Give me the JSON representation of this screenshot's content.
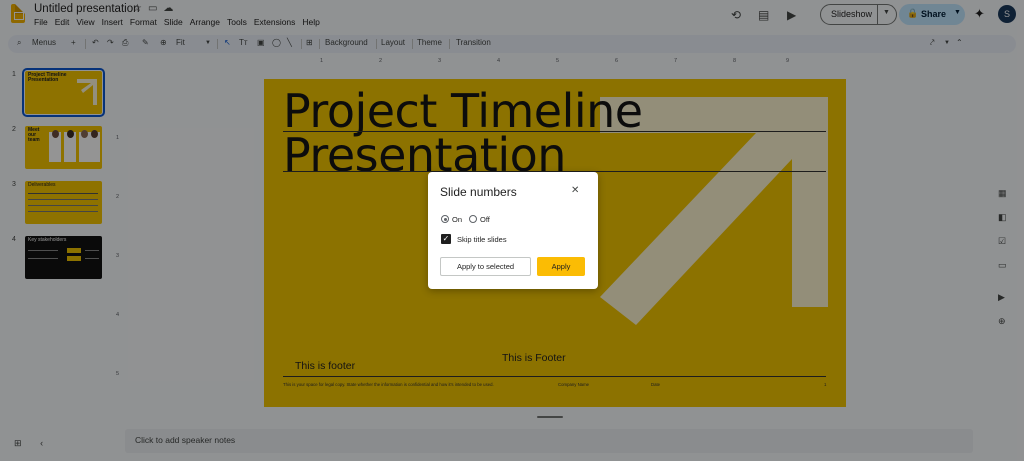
{
  "app": {
    "doc_title": "Untitled presentation",
    "menus": [
      "File",
      "Edit",
      "View",
      "Insert",
      "Format",
      "Slide",
      "Arrange",
      "Tools",
      "Extensions",
      "Help"
    ],
    "slideshow_label": "Slideshow",
    "share_label": "Share",
    "avatar_letter": "S"
  },
  "toolbar": {
    "search_label": "Menus",
    "zoom_label": "Fit",
    "background_label": "Background",
    "layout_label": "Layout",
    "theme_label": "Theme",
    "transition_label": "Transition"
  },
  "filmstrip": {
    "slides": [
      {
        "num": "1",
        "title": "Project Timeline Presentation"
      },
      {
        "num": "2",
        "title": "Meet our team"
      },
      {
        "num": "3",
        "title": "Deliverables"
      },
      {
        "num": "4",
        "title": "Key stakeholders"
      }
    ]
  },
  "ruler": {
    "h": [
      "1",
      "2",
      "3",
      "4",
      "5",
      "6",
      "7",
      "8",
      "9"
    ],
    "v": [
      "1",
      "2",
      "3",
      "4",
      "5"
    ]
  },
  "slide": {
    "title_line1": "Project Timeline",
    "title_line2": "Presentation",
    "footer_left": "This is footer",
    "footer_center": "This is Footer",
    "small_text": "This is your space for legal copy. State whether the information is confidential and how it's intended to be used.",
    "company": "Company Name",
    "date": "Date",
    "page_no": "1",
    "accent": "#f2c500"
  },
  "dialog": {
    "title": "Slide numbers",
    "on_label": "On",
    "off_label": "Off",
    "selected": "On",
    "skip_title_label": "Skip title slides",
    "skip_title_checked": true,
    "apply_selected_label": "Apply to selected",
    "apply_label": "Apply"
  },
  "notes": {
    "placeholder": "Click to add speaker notes"
  }
}
